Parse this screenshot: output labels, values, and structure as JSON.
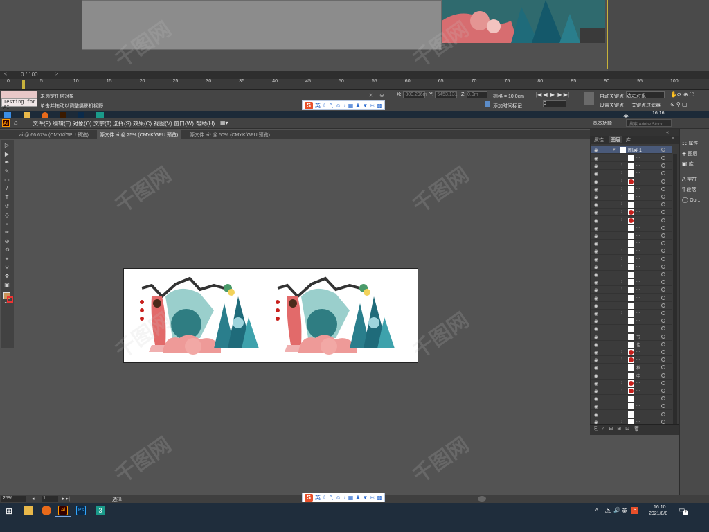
{
  "max_app": {
    "timeline_frame": "0 / 100",
    "ruler_ticks": [
      "0",
      "5",
      "10",
      "15",
      "20",
      "25",
      "30",
      "35",
      "40",
      "45",
      "50",
      "55",
      "60",
      "65",
      "70",
      "75",
      "80",
      "85",
      "90",
      "95",
      "100"
    ],
    "status_line1": "未选定任何对象",
    "status_line2": "单击并拖动以调整摄影机视野",
    "testing_label": "Testing for AI",
    "x_label": "X:",
    "x_value": "-300.296m",
    "y_label": "Y:",
    "y_value": "-5453.131",
    "z_label": "Z:",
    "z_value": "0.0m",
    "grid_label": "栅格 = 10.0cm",
    "add_time_tag": "添加时间标记",
    "auto_key": "自动关键点",
    "selected_obj": "选定对象",
    "set_key": "设置关键点",
    "key_filter": "关键点过滤器",
    "frame_value": "0",
    "time": "16:16"
  },
  "ime": {
    "logo": "S",
    "mode": "英",
    "icons": [
      "moon-icon",
      "comma-icon",
      "smile-icon",
      "mic-icon",
      "keyboard-icon",
      "person-icon",
      "shirt-icon",
      "scissors-icon",
      "grid-icon"
    ]
  },
  "ai_app": {
    "logo": "Ai",
    "menus": [
      "文件(F)",
      "编辑(E)",
      "对象(O)",
      "文字(T)",
      "选择(S)",
      "效果(C)",
      "视图(V)",
      "窗口(W)",
      "帮助(H)"
    ],
    "workspace": "基本功能",
    "search_placeholder": "搜索 Adobe Stock",
    "tabs": [
      {
        "label": "...ai @ 66.67% (CMYK/GPU 预览)",
        "active": false
      },
      {
        "label": "源文件.ai @ 25% (CMYK/GPU 预览)",
        "active": true
      },
      {
        "label": "源文件.ai* @ 50% (CMYK/GPU 预览)",
        "active": false
      }
    ],
    "panel_tabs": [
      "属性",
      "图层",
      "库"
    ],
    "layer_top": "图层 1",
    "layer_rows": [
      {
        "thumb": "white",
        "name": "...",
        "arrow": false
      },
      {
        "thumb": "white",
        "name": "...",
        "arrow": true
      },
      {
        "thumb": "white",
        "name": "...",
        "arrow": true
      },
      {
        "thumb": "red",
        "name": "...",
        "arrow": true
      },
      {
        "thumb": "white",
        "name": "...",
        "arrow": true
      },
      {
        "thumb": "white",
        "name": "...",
        "arrow": true
      },
      {
        "thumb": "white",
        "name": "...",
        "arrow": true
      },
      {
        "thumb": "red",
        "name": "...",
        "arrow": true
      },
      {
        "thumb": "red",
        "name": "...",
        "arrow": true
      },
      {
        "thumb": "white",
        "name": "...",
        "arrow": false
      },
      {
        "thumb": "white",
        "name": "...",
        "arrow": false
      },
      {
        "thumb": "white",
        "name": "...",
        "arrow": false
      },
      {
        "thumb": "white",
        "name": "...",
        "arrow": true
      },
      {
        "thumb": "white",
        "name": "...",
        "arrow": true
      },
      {
        "thumb": "white",
        "name": "...",
        "arrow": true
      },
      {
        "thumb": "white",
        "name": "...",
        "arrow": false
      },
      {
        "thumb": "white",
        "name": "...",
        "arrow": true
      },
      {
        "thumb": "white",
        "name": "...",
        "arrow": true
      },
      {
        "thumb": "white",
        "name": "...",
        "arrow": false
      },
      {
        "thumb": "white",
        "name": "...",
        "arrow": false
      },
      {
        "thumb": "white",
        "name": "...",
        "arrow": true
      },
      {
        "thumb": "white",
        "name": "...",
        "arrow": false
      },
      {
        "thumb": "white",
        "name": "...",
        "arrow": false
      },
      {
        "thumb": "white",
        "name": "节",
        "arrow": false
      },
      {
        "thumb": "white",
        "name": "佳",
        "arrow": false
      },
      {
        "thumb": "red",
        "name": "...",
        "arrow": true
      },
      {
        "thumb": "red",
        "name": "...",
        "arrow": true
      },
      {
        "thumb": "white",
        "name": "秋",
        "arrow": false
      },
      {
        "thumb": "white",
        "name": "中",
        "arrow": false
      },
      {
        "thumb": "red",
        "name": "...",
        "arrow": true
      },
      {
        "thumb": "red",
        "name": "...",
        "arrow": true
      },
      {
        "thumb": "white",
        "name": "...",
        "arrow": false
      },
      {
        "thumb": "white",
        "name": "...",
        "arrow": false
      },
      {
        "thumb": "white",
        "name": "...",
        "arrow": false
      },
      {
        "thumb": "white",
        "name": "...",
        "arrow": true
      }
    ],
    "props_items": [
      "属性",
      "图层",
      "库",
      "字符",
      "段落",
      "Op..."
    ],
    "zoom": "25%",
    "page": "1",
    "status_tool": "选择"
  },
  "taskbar": {
    "ime_mode": "英",
    "time": "16:10",
    "date": "2021/8/8",
    "notification_count": "2"
  },
  "watermark": "千图网"
}
